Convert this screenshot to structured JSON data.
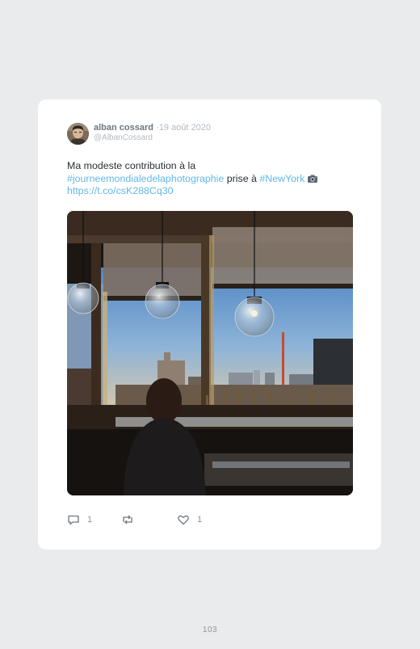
{
  "tweet": {
    "author_name": "alban cossard",
    "separator": "·",
    "date": "19 août 2020",
    "handle": "@AlbanCossard",
    "text_part1": "Ma modeste contribution à la",
    "hashtag1": "#journeemondialedelaphotographie",
    "text_part2": " prise à ",
    "hashtag2": "#NewYork",
    "link": "https://t.co/csK288Cq30",
    "photo_icon": "camera-icon"
  },
  "actions": {
    "reply_count": "1",
    "like_count": "1"
  },
  "colors": {
    "link": "#60b8e8",
    "page_background": "#e9ebed",
    "card_background": "#ffffff"
  },
  "page": {
    "number": "103"
  }
}
